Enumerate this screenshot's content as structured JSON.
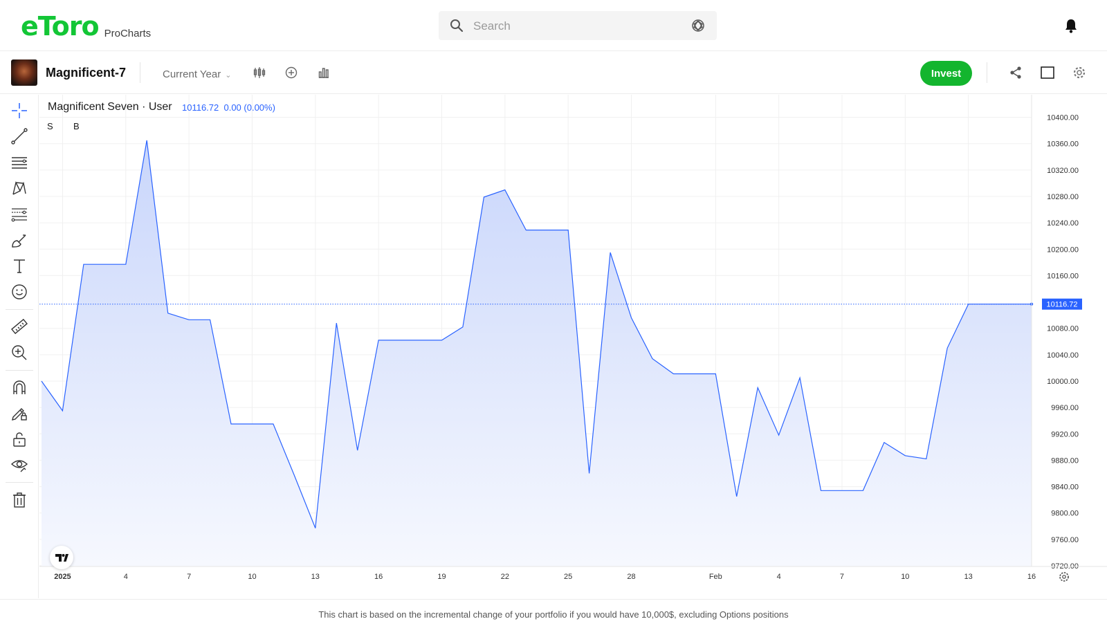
{
  "header": {
    "logo_text": "eToro",
    "logo_sub": "ProCharts",
    "search_placeholder": "Search"
  },
  "instrument": {
    "name": "Magnificent-7",
    "range_label": "Current Year",
    "invest_label": "Invest"
  },
  "chart_header": {
    "title": "Magnificent Seven · User",
    "values": "10116.72  0.00 (0.00%)",
    "marker_s": "S",
    "marker_b": "B"
  },
  "footer": {
    "note": "This chart is based on the incremental change of your portfolio if you would have 10,000$, excluding Options positions"
  },
  "colors": {
    "brand_green": "#13c636",
    "invest_green": "#13b52e",
    "line": "#2962ff",
    "area_top": "#c9d6fb",
    "area_bottom": "#f6f8fe"
  },
  "chart_data": {
    "type": "area",
    "title": "Magnificent Seven · User",
    "xlabel": "",
    "ylabel": "",
    "ylim": [
      9720,
      10420
    ],
    "y_ticks": [
      10400,
      10360,
      10320,
      10280,
      10240,
      10200,
      10160,
      10080,
      10040,
      10000,
      9960,
      9920,
      9880,
      9840,
      9800,
      9760,
      9720
    ],
    "y_tick_labels": [
      "10400.00",
      "10360.00",
      "10320.00",
      "10280.00",
      "10240.00",
      "10200.00",
      "10160.00",
      "10080.00",
      "10040.00",
      "10000.00",
      "9960.00",
      "9920.00",
      "9880.00",
      "9840.00",
      "9800.00",
      "9760.00",
      "9720.00"
    ],
    "x_ticks": [
      1,
      4,
      7,
      10,
      13,
      16,
      19,
      22,
      25,
      28,
      32,
      35,
      38,
      41,
      44,
      47
    ],
    "x_tick_labels": [
      "2025",
      "4",
      "7",
      "10",
      "13",
      "16",
      "19",
      "22",
      "25",
      "28",
      "Feb",
      "4",
      "7",
      "10",
      "13",
      "16"
    ],
    "xlim": [
      0,
      47
    ],
    "last_value": 10116.72,
    "last_value_label": "10116.72",
    "grid": true,
    "series": [
      {
        "x": [
          0,
          1,
          2,
          3,
          4,
          5,
          6,
          7,
          8,
          9,
          10,
          11,
          12,
          13,
          14,
          15,
          16,
          17,
          18,
          19,
          20,
          21,
          22,
          23,
          24,
          25,
          26,
          27,
          28,
          29,
          30,
          31,
          32,
          33,
          34,
          35,
          36,
          37,
          38,
          39,
          40,
          41,
          42,
          43,
          44,
          45,
          46,
          47
        ],
        "values": [
          10000,
          9955,
          10177,
          10177,
          10177,
          10365,
          10103,
          10093,
          10093,
          9935,
          9935,
          9935,
          9857,
          9777,
          10088,
          9895,
          10062,
          10062,
          10062,
          10062,
          10082,
          10279,
          10290,
          10229,
          10229,
          10229,
          9860,
          10195,
          10096,
          10034,
          10011,
          10011,
          10011,
          9825,
          9990,
          9918,
          10005,
          9834,
          9834,
          9834,
          9907,
          9887,
          9882,
          10050,
          10116.72,
          10116.72,
          10116.72,
          10116.72
        ]
      }
    ]
  }
}
